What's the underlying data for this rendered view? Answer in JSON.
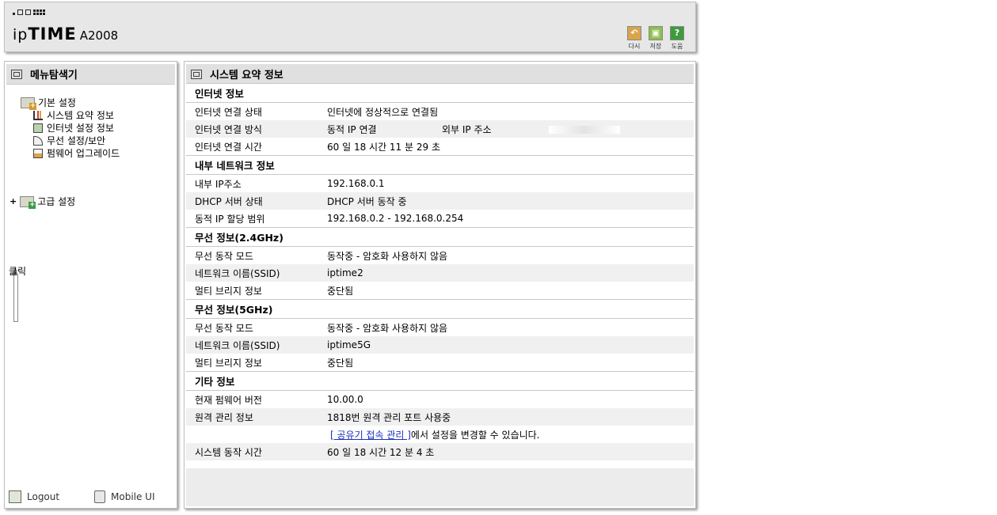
{
  "header": {
    "brand_ip": "ip",
    "brand_time": "TIME",
    "model": "A2008",
    "buttons": [
      {
        "label": "다시",
        "icon": "undo-icon",
        "color": "#d9a44a"
      },
      {
        "label": "저장",
        "icon": "save-icon",
        "color": "#8ec04f"
      },
      {
        "label": "도움",
        "icon": "help-icon",
        "color": "#3f9a3c"
      }
    ]
  },
  "sidebar": {
    "title": "메뉴탐색기",
    "basic_group": "기본 설정",
    "basic_items": [
      "시스템 요약 정보",
      "인터넷 설정 정보",
      "무선 설정/보안",
      "펌웨어 업그레이드"
    ],
    "advanced_group": "고급 설정",
    "advanced_toggle": "+",
    "hint": "클릭",
    "logout": "Logout",
    "mobile": "Mobile UI"
  },
  "main": {
    "title": "시스템 요약 정보",
    "sections": [
      {
        "title": "인터넷 정보",
        "rows": [
          {
            "label": "인터넷 연결 상태",
            "value": "인터넷에 정상적으로 연결됨"
          },
          {
            "label": "인터넷 연결 방식",
            "value": "동적 IP 연결",
            "extra_label": "외부 IP 주소"
          },
          {
            "label": "인터넷 연결 시간",
            "value": "60 일 18 시간 11 분 29 초"
          }
        ]
      },
      {
        "title": "내부 네트워크 정보",
        "rows": [
          {
            "label": "내부 IP주소",
            "value": "192.168.0.1"
          },
          {
            "label": "DHCP 서버 상태",
            "value": "DHCP 서버 동작 중"
          },
          {
            "label": "동적 IP 할당 범위",
            "value": "192.168.0.2 -  192.168.0.254"
          }
        ]
      },
      {
        "title": "무선 정보(2.4GHz)",
        "rows": [
          {
            "label": "무선 동작 모드",
            "value": "동작중 - 암호화 사용하지 않음"
          },
          {
            "label": "네트워크 이름(SSID)",
            "value": "iptime2"
          },
          {
            "label": "멀티 브리지 정보",
            "value": "중단됨"
          }
        ]
      },
      {
        "title": "무선 정보(5GHz)",
        "rows": [
          {
            "label": "무선 동작 모드",
            "value": "동작중 - 암호화 사용하지 않음"
          },
          {
            "label": "네트워크 이름(SSID)",
            "value": "iptime5G"
          },
          {
            "label": "멀티 브리지 정보",
            "value": "중단됨"
          }
        ]
      },
      {
        "title": "기타 정보",
        "rows": [
          {
            "label": "현재 펌웨어 버전",
            "value": "10.00.0"
          },
          {
            "label": "원격 관리 정보",
            "value": "1818번 원격 관리 포트 사용중"
          },
          {
            "label": "",
            "link": "[ 공유기 접속 관리 ]",
            "value_after": "에서 설정을 변경할 수 있습니다."
          },
          {
            "label": "시스템 동작 시간",
            "value": "60 일 18 시간 12 분 4 초"
          }
        ]
      }
    ]
  }
}
